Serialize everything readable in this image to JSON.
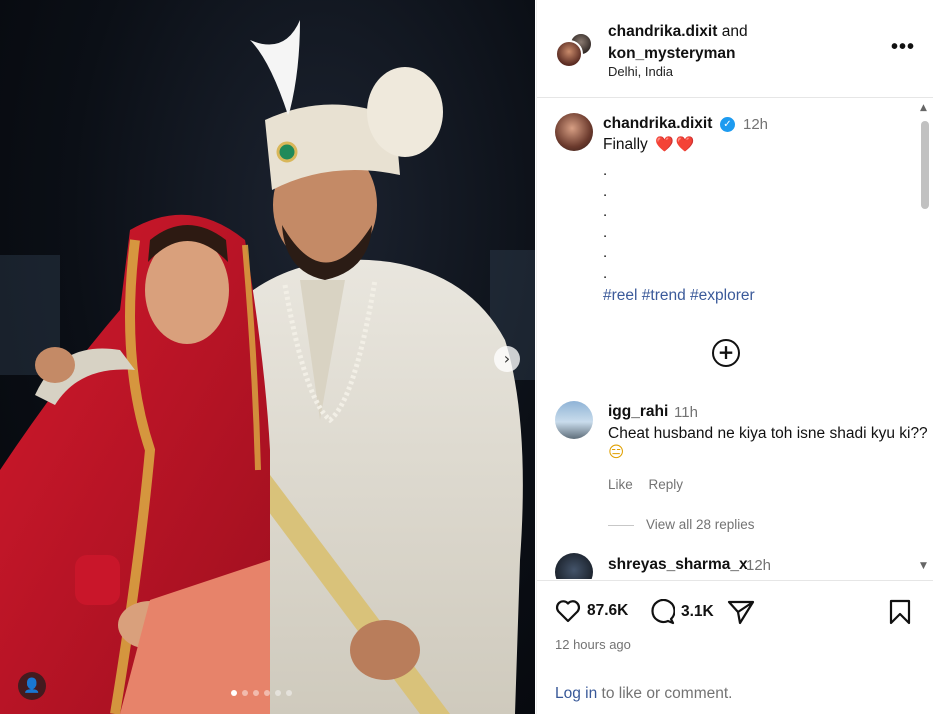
{
  "post": {
    "author": "chandrika.dixit",
    "collaborator": "kon_mysteryman",
    "joiner": "and",
    "location": "Delhi, India",
    "more_icon": "more-options-icon"
  },
  "caption": {
    "user": "chandrika.dixit",
    "verified_icon": "verified-badge-icon",
    "time": "12h",
    "text": "Finally",
    "hearts": "❤️❤️",
    "dots": [
      ".",
      ".",
      ".",
      ".",
      ".",
      "."
    ],
    "hashtags": [
      "#reel",
      "#trend",
      "#explorer"
    ]
  },
  "load_more_icon": "plus-circle-icon",
  "comments": [
    {
      "user": "igg_rahi",
      "time": "11h",
      "text": "Cheat husband ne kiya toh isne shadi kyu ki??",
      "emoji": "😑",
      "like_label": "Like",
      "reply_label": "Reply",
      "view_replies": "View all 28 replies"
    },
    {
      "user": "shreyas_sharma_x",
      "time": "12h"
    }
  ],
  "footer": {
    "likes": "87.6K",
    "comments": "3.1K",
    "posted": "12 hours ago",
    "login_link": "Log in",
    "login_rest": " to like or comment."
  },
  "carousel": {
    "slides": 6,
    "active_index": 0
  },
  "colors": {
    "link": "#3b5a9a",
    "muted": "#737373",
    "verified": "#1d9bf0",
    "heart": "#e0142f"
  }
}
